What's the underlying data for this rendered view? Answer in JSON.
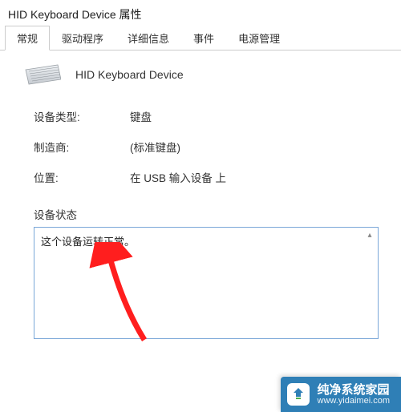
{
  "window_title": "HID Keyboard Device 属性",
  "tabs": [
    {
      "label": "常规",
      "active": true
    },
    {
      "label": "驱动程序",
      "active": false
    },
    {
      "label": "详细信息",
      "active": false
    },
    {
      "label": "事件",
      "active": false
    },
    {
      "label": "电源管理",
      "active": false
    }
  ],
  "device_name": "HID Keyboard Device",
  "info": {
    "type_label": "设备类型:",
    "type_value": "键盘",
    "manufacturer_label": "制造商:",
    "manufacturer_value": "(标准键盘)",
    "location_label": "位置:",
    "location_value": "在 USB 输入设备 上"
  },
  "status": {
    "label": "设备状态",
    "text": "这个设备运转正常。"
  },
  "watermark": {
    "brand": "纯净系统家园",
    "url": "www.yidaimei.com"
  },
  "colors": {
    "accent": "#7aa7d8",
    "arrow": "#ff1e1e",
    "wm_bg": "#2f7fb6"
  }
}
